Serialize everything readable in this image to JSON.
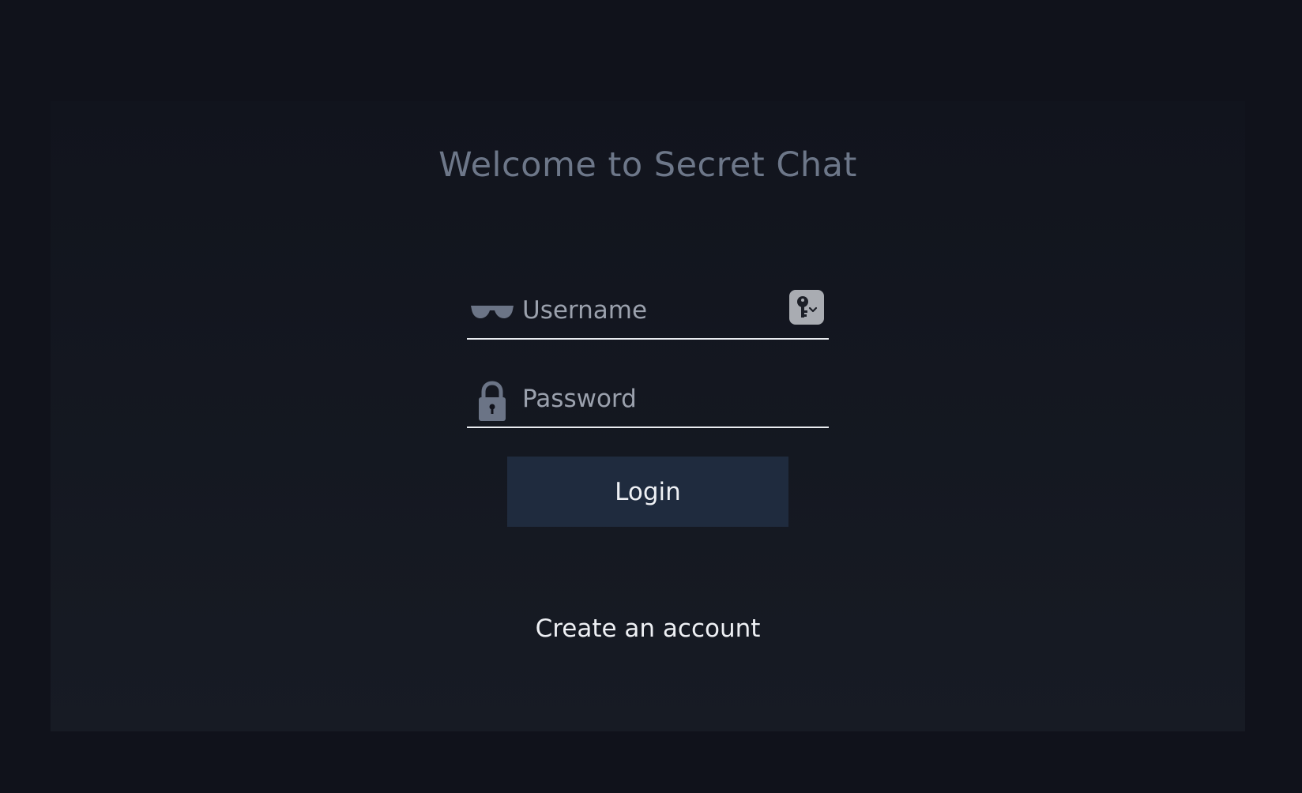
{
  "page": {
    "title": "Welcome to Secret Chat"
  },
  "form": {
    "username": {
      "placeholder": "Username",
      "value": "",
      "icon": "sunglasses-icon"
    },
    "password": {
      "placeholder": "Password",
      "value": "",
      "icon": "lock-icon"
    },
    "password_manager_icon": "key-dropdown-icon",
    "login_label": "Login",
    "create_account_label": "Create an account"
  },
  "colors": {
    "background": "#10121b",
    "card": "#151922",
    "title": "#6d7789",
    "icon": "#6b7486",
    "button": "#1f2b3e",
    "underline": "#e9ecf0"
  }
}
